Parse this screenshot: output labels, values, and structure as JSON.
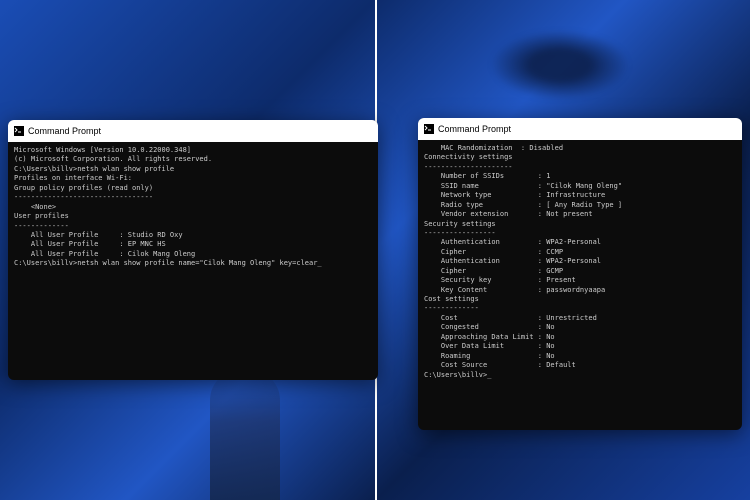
{
  "left": {
    "title": "Command Prompt",
    "lines": [
      "Microsoft Windows [Version 10.0.22000.348]",
      "(c) Microsoft Corporation. All rights reserved.",
      "",
      "C:\\Users\\billv>netsh wlan show profile",
      "",
      "Profiles on interface Wi-Fi:",
      "",
      "Group policy profiles (read only)",
      "---------------------------------",
      "    <None>",
      "",
      "User profiles",
      "-------------",
      "    All User Profile     : Studio RD Oxy",
      "    All User Profile     : EP MNC HS",
      "    All User Profile     : Cilok Mang Oleng",
      "",
      "C:\\Users\\billv>netsh wlan show profile name=\"Cilok Mang Oleng\" key=clear_"
    ]
  },
  "right": {
    "title": "Command Prompt",
    "lines": [
      "    MAC Randomization  : Disabled",
      "",
      "Connectivity settings",
      "---------------------",
      "    Number of SSIDs        : 1",
      "    SSID name              : \"Cilok Mang Oleng\"",
      "    Network type           : Infrastructure",
      "    Radio type             : [ Any Radio Type ]",
      "    Vendor extension       : Not present",
      "",
      "Security settings",
      "-----------------",
      "    Authentication         : WPA2-Personal",
      "    Cipher                 : CCMP",
      "    Authentication         : WPA2-Personal",
      "    Cipher                 : GCMP",
      "    Security key           : Present",
      "    Key Content            : passwordnyaapa",
      "",
      "Cost settings",
      "-------------",
      "    Cost                   : Unrestricted",
      "    Congested              : No",
      "    Approaching Data Limit : No",
      "    Over Data Limit        : No",
      "    Roaming                : No",
      "    Cost Source            : Default",
      "",
      "C:\\Users\\billv>_"
    ]
  }
}
